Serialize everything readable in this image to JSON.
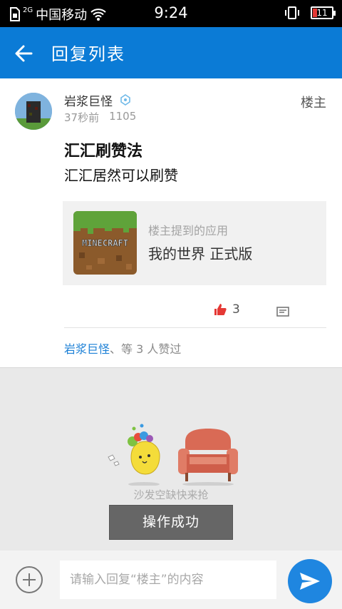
{
  "status_bar": {
    "network": "2G",
    "carrier": "中国移动",
    "time": "9:24",
    "battery_level": "11"
  },
  "header": {
    "title": "回复列表"
  },
  "post": {
    "author_name": "岩浆巨怪",
    "time_ago": "37秒前",
    "view_count": "1105",
    "owner_tag": "楼主",
    "title": "汇汇刷赞法",
    "body": "汇汇居然可以刷赞",
    "app_card": {
      "hint": "楼主提到的应用",
      "name": "我的世界 正式版",
      "icon_text": "MINECRAFT"
    },
    "like_count": "3",
    "likers": {
      "link_name": "岩浆巨怪",
      "suffix": "、等 3 人赞过"
    }
  },
  "empty_state": {
    "text": "沙发空缺快来抢"
  },
  "toast": {
    "text": "操作成功"
  },
  "reply_bar": {
    "placeholder": "请输入回复“楼主”的内容"
  },
  "colors": {
    "brand_blue": "#0b7bd6",
    "like_red": "#e53935",
    "link_blue": "#1a7fd6"
  }
}
